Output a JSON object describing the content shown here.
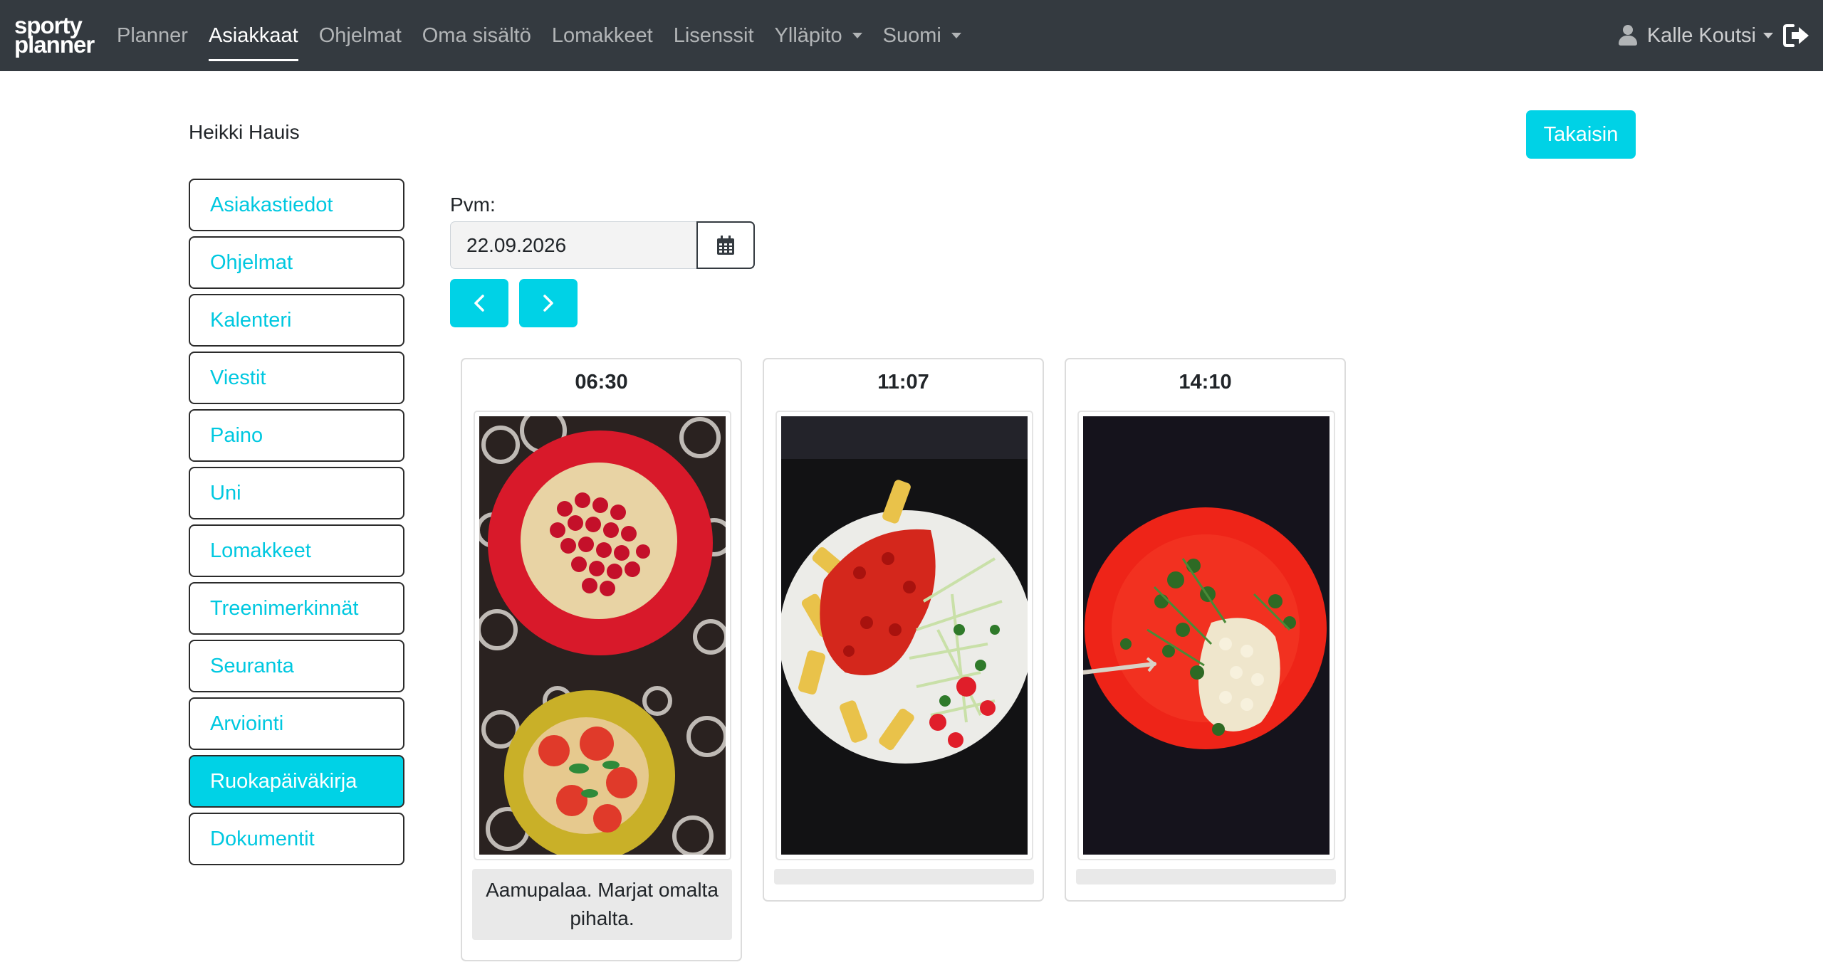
{
  "nav": {
    "logo_line1": "sporty",
    "logo_line2": "planner",
    "items": [
      "Planner",
      "Asiakkaat",
      "Ohjelmat",
      "Oma sisältö",
      "Lomakkeet",
      "Lisenssit",
      "Ylläpito",
      "Suomi"
    ],
    "active_item": "Asiakkaat",
    "user_name": "Kalle Koutsi"
  },
  "page": {
    "client_name": "Heikki Hauis",
    "back_label": "Takaisin"
  },
  "sidebar": {
    "items": [
      "Asiakastiedot",
      "Ohjelmat",
      "Kalenteri",
      "Viestit",
      "Paino",
      "Uni",
      "Lomakkeet",
      "Treenimerkinnät",
      "Seuranta",
      "Arviointi",
      "Ruokapäiväkirja",
      "Dokumentit"
    ],
    "active_item": "Ruokapäiväkirja"
  },
  "date": {
    "label": "Pvm:",
    "value": "22.09.2026"
  },
  "entries": [
    {
      "time": "06:30",
      "note": "Aamupalaa. Marjat omalta pihalta."
    },
    {
      "time": "11:07",
      "note": ""
    },
    {
      "time": "14:10",
      "note": ""
    }
  ],
  "colors": {
    "navbar": "#343a40",
    "accent": "#00d2e6",
    "link": "#00c8e0"
  }
}
